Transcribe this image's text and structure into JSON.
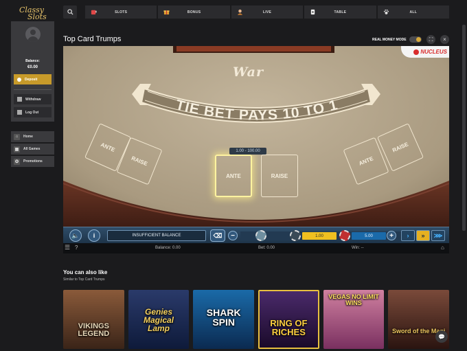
{
  "brand": {
    "line1": "Classy",
    "line2": "Slots",
    "accent": "#c79a2a"
  },
  "nav": [
    {
      "label": "SLOTS",
      "icon": "slot-machine-icon"
    },
    {
      "label": "BONUS",
      "icon": "gift-icon"
    },
    {
      "label": "LIVE",
      "icon": "dealer-icon"
    },
    {
      "label": "TABLE",
      "icon": "card-icon"
    },
    {
      "label": "ALL",
      "icon": "paw-icon"
    }
  ],
  "account": {
    "balance_label": "Balance:",
    "balance_value": "€0.00",
    "deposit_label": "Deposit",
    "withdraw_label": "Withdraw",
    "logout_label": "Log Out"
  },
  "sidebar_nav": [
    {
      "label": "Home",
      "icon": "home-icon"
    },
    {
      "label": "All Games",
      "icon": "grid-icon"
    },
    {
      "label": "Promotions",
      "icon": "promo-icon"
    }
  ],
  "game": {
    "title": "Top Card Trumps",
    "real_money_label": "REAL MONEY MODE",
    "real_money_on": true,
    "table_title": "War",
    "banner_text": "TIE BET PAYS 10 TO 1",
    "provider": "NUCLEUS",
    "left_boxes": [
      "ANTE",
      "RAISE"
    ],
    "center_boxes": [
      "ANTE",
      "RAISE"
    ],
    "right_boxes": [
      "ANTE",
      "RAISE"
    ],
    "bet_range": "1.00 - 100.00",
    "status_message": "INSUFFICIENT BALANCE",
    "chip_value_selected": "1.00",
    "chip_value_other": "5.00",
    "balance_text": "Balance: 0.00",
    "bet_text": "Bet: 0.00",
    "win_text": "Win: --"
  },
  "recommendations": {
    "title": "You can also like",
    "subtitle": "Similar to Top Card Trumps",
    "games": [
      {
        "title": "VIKINGS LEGEND"
      },
      {
        "title": "Genies Magical Lamp"
      },
      {
        "title": "SHARK SPIN"
      },
      {
        "title": "RING OF RICHES"
      },
      {
        "title": "VEGAS NO LIMIT WINS"
      },
      {
        "title": "Sword of the Magi"
      }
    ]
  }
}
